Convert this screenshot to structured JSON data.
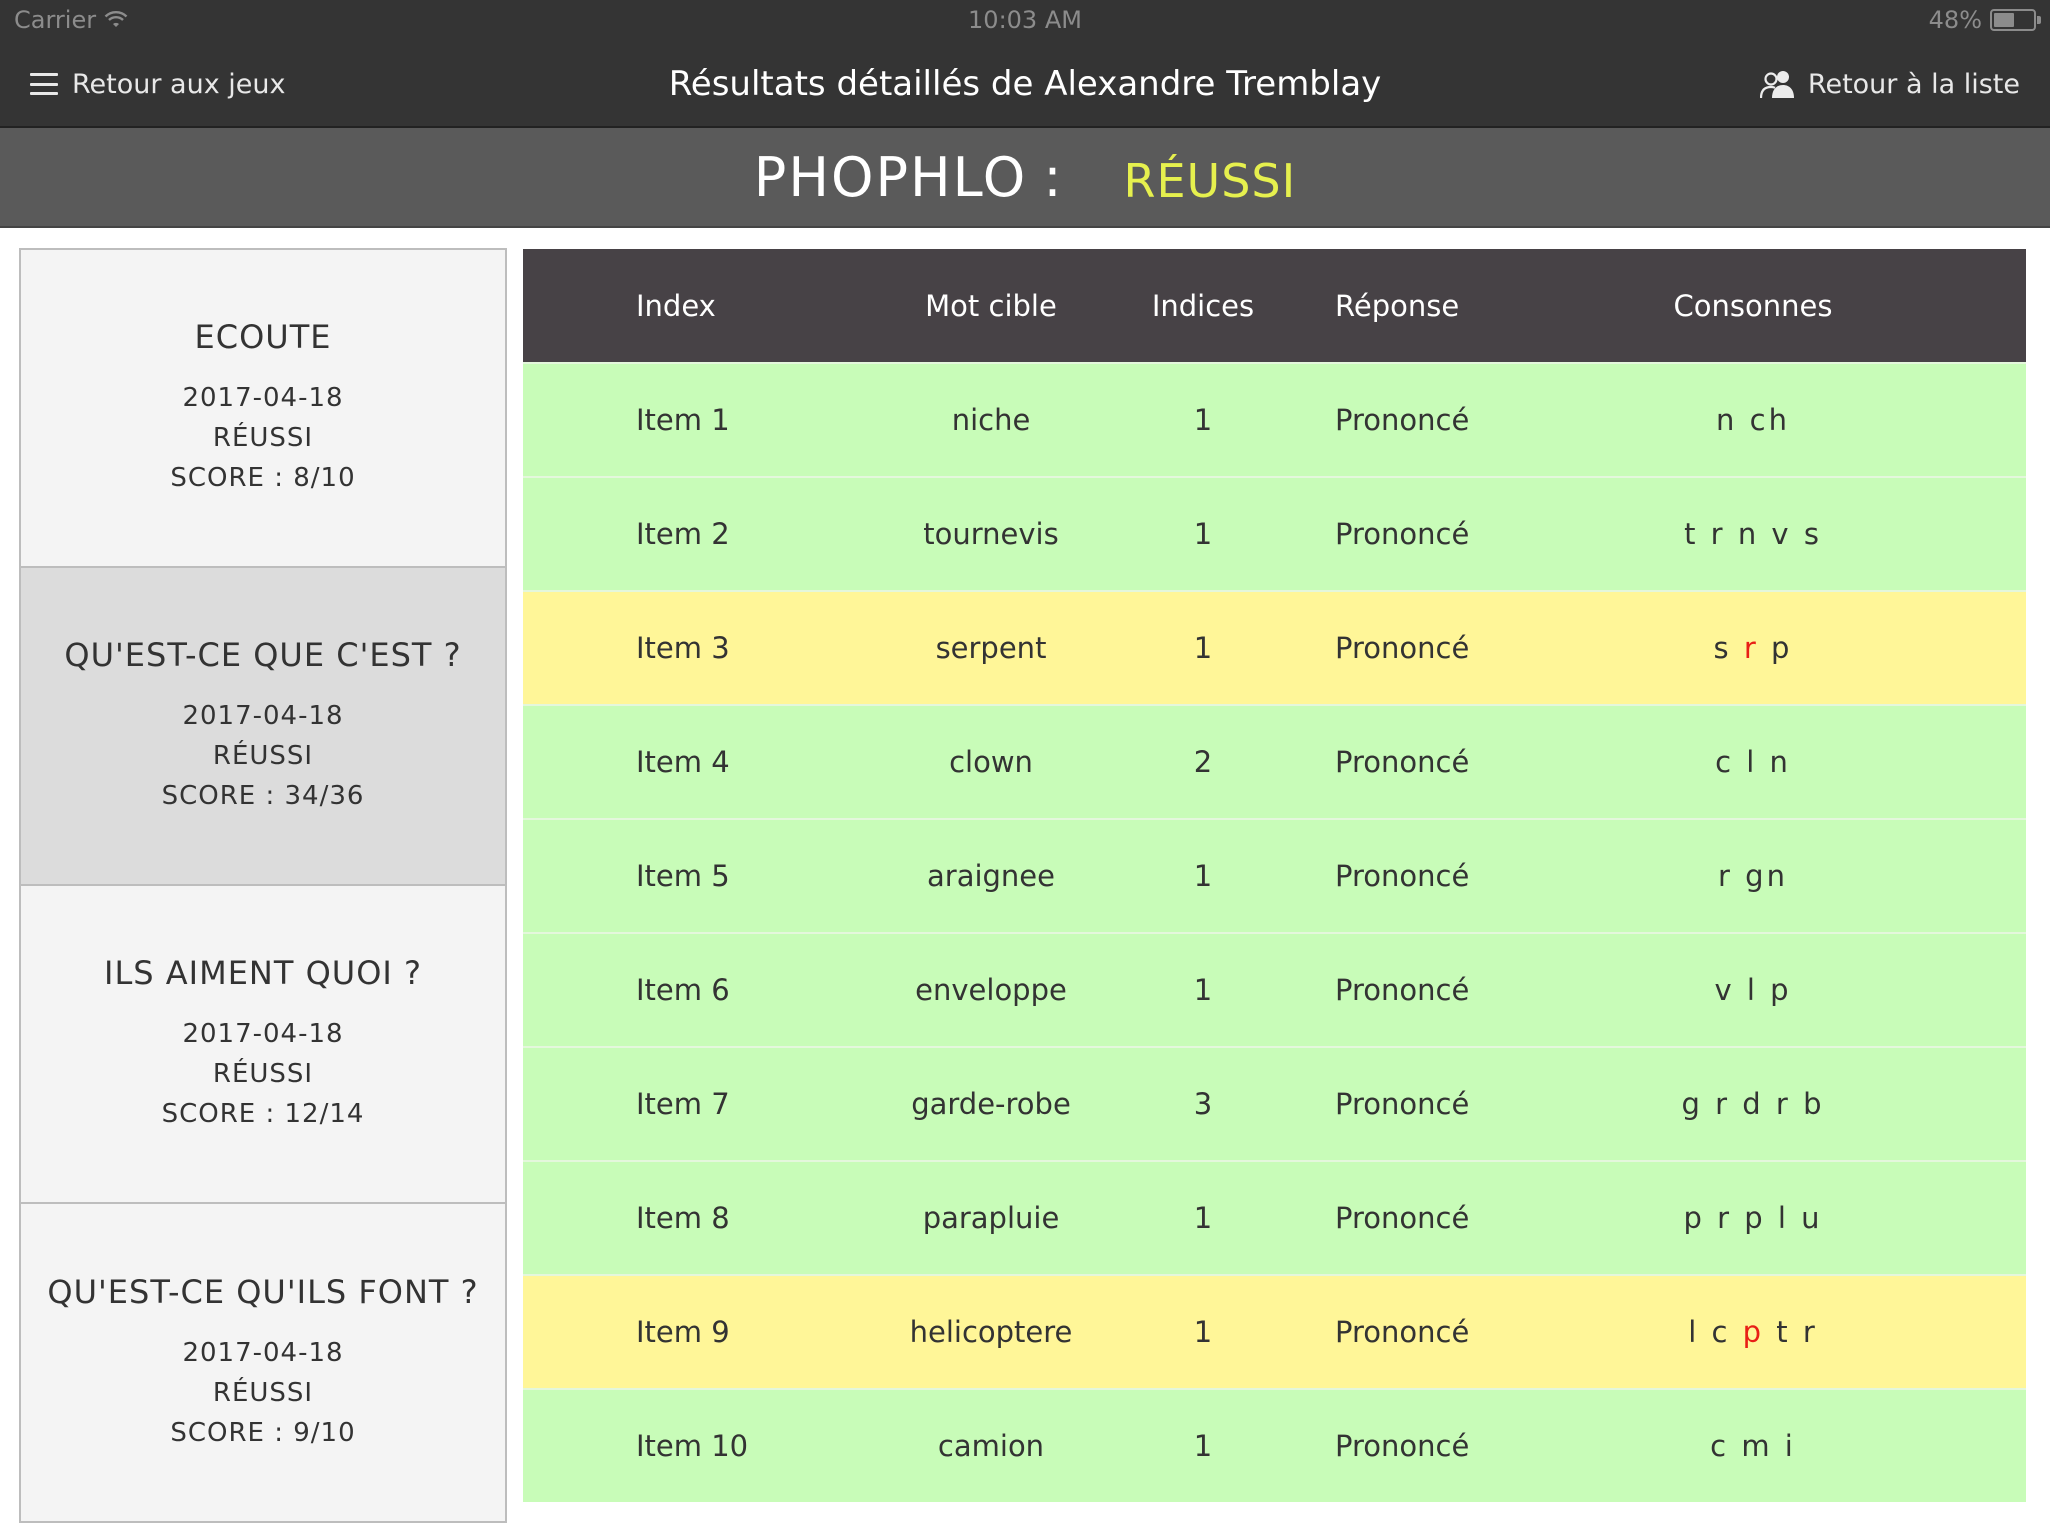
{
  "status_bar": {
    "carrier": "Carrier",
    "time": "10:03 AM",
    "battery": "48%",
    "battery_level": 0.48
  },
  "navbar": {
    "back_label": "Retour aux jeux",
    "title": "Résultats détaillés de Alexandre Tremblay",
    "list_label": "Retour à la liste"
  },
  "game": {
    "name": "PHOPHLO",
    "colon": ":",
    "status": "RÉUSSI",
    "status_color": "#e6f04e"
  },
  "activities": [
    {
      "title": "ECOUTE",
      "date": "2017-04-18",
      "status": "RÉUSSI",
      "score": "SCORE : 8/10",
      "selected": false
    },
    {
      "title": "QU'EST-CE QUE C'EST ?",
      "date": "2017-04-18",
      "status": "RÉUSSI",
      "score": "SCORE : 34/36",
      "selected": true
    },
    {
      "title": "ILS AIMENT QUOI ?",
      "date": "2017-04-18",
      "status": "RÉUSSI",
      "score": "SCORE : 12/14",
      "selected": false
    },
    {
      "title": "QU'EST-CE QU'ILS FONT ?",
      "date": "2017-04-18",
      "status": "RÉUSSI",
      "score": "SCORE : 9/10",
      "selected": false
    }
  ],
  "table": {
    "headers": [
      "Index",
      "Mot cible",
      "Indices",
      "Réponse",
      "Consonnes"
    ],
    "rows": [
      {
        "index": "Item 1",
        "word": "niche",
        "hints": "1",
        "response": "Prononcé",
        "consonants": [
          {
            "t": "n"
          },
          {
            "t": "ch"
          }
        ],
        "status": "ok"
      },
      {
        "index": "Item 2",
        "word": "tournevis",
        "hints": "1",
        "response": "Prononcé",
        "consonants": [
          {
            "t": "t"
          },
          {
            "t": "r"
          },
          {
            "t": "n"
          },
          {
            "t": "v"
          },
          {
            "t": "s"
          }
        ],
        "status": "ok"
      },
      {
        "index": "Item 3",
        "word": "serpent",
        "hints": "1",
        "response": "Prononcé",
        "consonants": [
          {
            "t": "s"
          },
          {
            "t": "r",
            "err": true
          },
          {
            "t": "p"
          }
        ],
        "status": "warn"
      },
      {
        "index": "Item 4",
        "word": "clown",
        "hints": "2",
        "response": "Prononcé",
        "consonants": [
          {
            "t": "c"
          },
          {
            "t": "l"
          },
          {
            "t": "n"
          }
        ],
        "status": "ok"
      },
      {
        "index": "Item 5",
        "word": "araignee",
        "hints": "1",
        "response": "Prononcé",
        "consonants": [
          {
            "t": "r"
          },
          {
            "t": "gn"
          }
        ],
        "status": "ok"
      },
      {
        "index": "Item 6",
        "word": "enveloppe",
        "hints": "1",
        "response": "Prononcé",
        "consonants": [
          {
            "t": "v"
          },
          {
            "t": "l"
          },
          {
            "t": "p"
          }
        ],
        "status": "ok"
      },
      {
        "index": "Item 7",
        "word": "garde-robe",
        "hints": "3",
        "response": "Prononcé",
        "consonants": [
          {
            "t": "g"
          },
          {
            "t": "r"
          },
          {
            "t": "d"
          },
          {
            "t": "r"
          },
          {
            "t": "b"
          }
        ],
        "status": "ok"
      },
      {
        "index": "Item 8",
        "word": "parapluie",
        "hints": "1",
        "response": "Prononcé",
        "consonants": [
          {
            "t": "p"
          },
          {
            "t": "r"
          },
          {
            "t": "p"
          },
          {
            "t": "l"
          },
          {
            "t": "u"
          }
        ],
        "status": "ok"
      },
      {
        "index": "Item 9",
        "word": "helicoptere",
        "hints": "1",
        "response": "Prononcé",
        "consonants": [
          {
            "t": "l"
          },
          {
            "t": "c"
          },
          {
            "t": "p",
            "err": true
          },
          {
            "t": "t"
          },
          {
            "t": "r"
          }
        ],
        "status": "warn"
      },
      {
        "index": "Item 10",
        "word": "camion",
        "hints": "1",
        "response": "Prononcé",
        "consonants": [
          {
            "t": "c"
          },
          {
            "t": "m"
          },
          {
            "t": "i"
          }
        ],
        "status": "ok"
      }
    ],
    "colors": {
      "ok": "#c8fcb8",
      "warn": "#fff698",
      "error_letter": "#e81f16",
      "header": "#474246"
    }
  }
}
